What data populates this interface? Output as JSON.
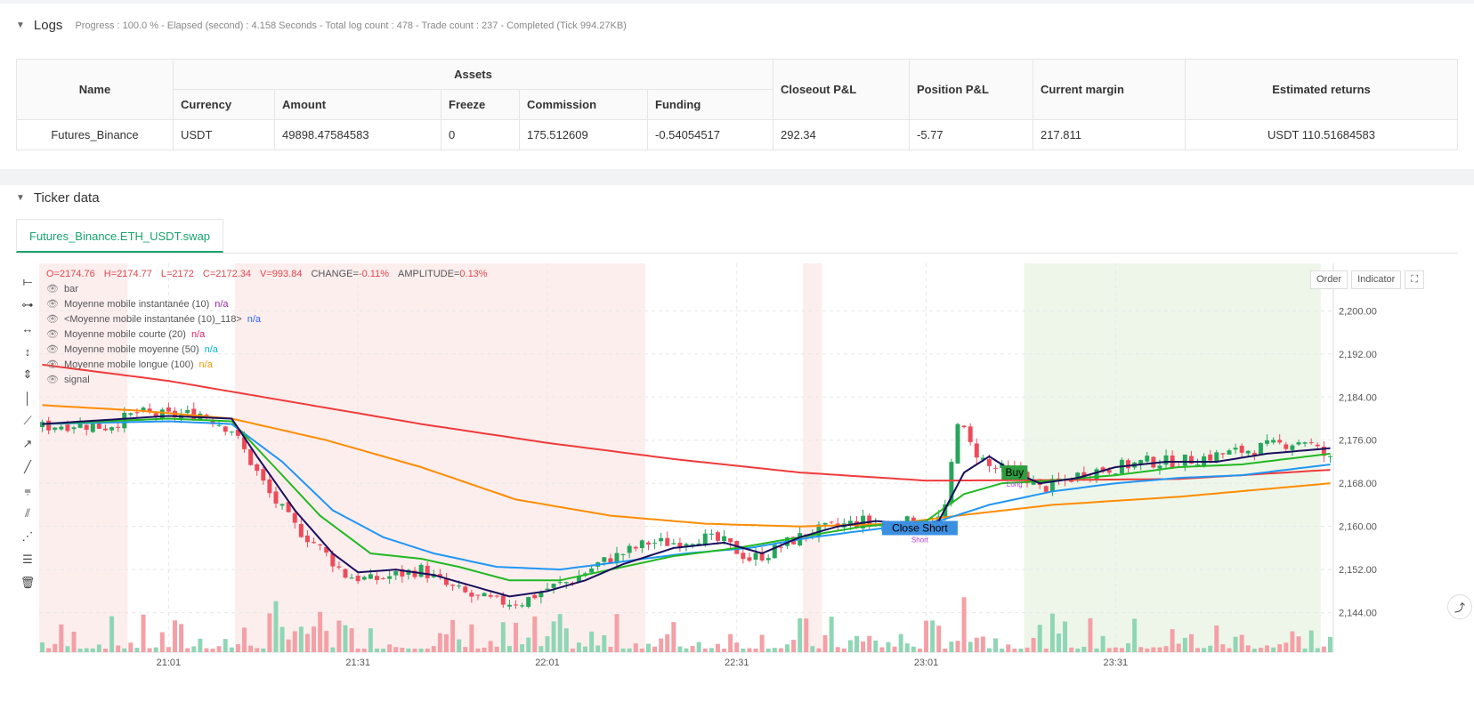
{
  "logs": {
    "title": "Logs",
    "progress": "Progress : 100.0 % - Elapsed (second) : 4.158  Seconds - Total log count : 478 - Trade count : 237 - Completed (Tick 994.27KB)",
    "table": {
      "h_name": "Name",
      "h_assets": "Assets",
      "h_currency": "Currency",
      "h_amount": "Amount",
      "h_freeze": "Freeze",
      "h_commission": "Commission",
      "h_funding": "Funding",
      "h_closeout": "Closeout P&L",
      "h_position": "Position P&L",
      "h_margin": "Current margin",
      "h_returns": "Estimated returns",
      "row": {
        "name": "Futures_Binance",
        "currency": "USDT",
        "amount": "49898.47584583",
        "freeze": "0",
        "commission": "175.512609",
        "funding": "-0.54054517",
        "closeout": "292.34",
        "position": "-5.77",
        "margin": "217.811",
        "returns": "USDT 110.51684583"
      }
    }
  },
  "ticker": {
    "title": "Ticker data",
    "tab": "Futures_Binance.ETH_USDT.swap",
    "buttons": {
      "order": "Order",
      "indicator": "Indicator"
    },
    "ohlc": {
      "o": "O=2174.76",
      "h": "H=2174.77",
      "l": "L=2172",
      "c": "C=2172.34",
      "v": "V=993.84",
      "change_label": "CHANGE=",
      "change": "-0.11%",
      "amp_label": "AMPLITUDE=",
      "amp": "0.13%"
    },
    "legend": [
      {
        "label": "bar",
        "value": ""
      },
      {
        "label": "Moyenne mobile instantanée (10)",
        "value": "n/a",
        "color": "#9c27b0"
      },
      {
        "label": "<Moyenne mobile instantanée (10)_118>",
        "value": "n/a",
        "color": "#2962ff"
      },
      {
        "label": "Moyenne mobile courte (20)",
        "value": "n/a",
        "color": "#e91e63"
      },
      {
        "label": "Moyenne mobile moyenne (50)",
        "value": "n/a",
        "color": "#00bcd4"
      },
      {
        "label": "Moyenne mobile longue (100)",
        "value": "n/a",
        "color": "#ff9800"
      },
      {
        "label": "signal",
        "value": ""
      }
    ]
  },
  "chart_data": {
    "type": "candlestick",
    "y_ticks": [
      "2,200.00",
      "2,192.00",
      "2,184.00",
      "2,176.00",
      "2,168.00",
      "2,160.00",
      "2,152.00",
      "2,144.00"
    ],
    "y_tick_values": [
      2200,
      2192,
      2184,
      2176,
      2168,
      2160,
      2152,
      2144
    ],
    "ylim": [
      2137.5,
      2208.8
    ],
    "x_ticks": [
      "21:01",
      "21:31",
      "22:01",
      "22:31",
      "23:01",
      "23:31"
    ],
    "x_tick_index": [
      20,
      50,
      80,
      110,
      140,
      170
    ],
    "bars": 205,
    "close_key_points": [
      [
        0,
        2178.5
      ],
      [
        5,
        2179
      ],
      [
        10,
        2178.5
      ],
      [
        15,
        2181
      ],
      [
        20,
        2180.5
      ],
      [
        25,
        2181
      ],
      [
        30,
        2178
      ],
      [
        33,
        2172
      ],
      [
        36,
        2166
      ],
      [
        40,
        2160
      ],
      [
        44,
        2156
      ],
      [
        48,
        2151
      ],
      [
        52,
        2150
      ],
      [
        56,
        2151
      ],
      [
        60,
        2152
      ],
      [
        64,
        2149
      ],
      [
        68,
        2147
      ],
      [
        72,
        2146
      ],
      [
        76,
        2146
      ],
      [
        80,
        2148.5
      ],
      [
        84,
        2150
      ],
      [
        88,
        2153
      ],
      [
        92,
        2155
      ],
      [
        96,
        2157
      ],
      [
        100,
        2157
      ],
      [
        104,
        2158
      ],
      [
        108,
        2157
      ],
      [
        112,
        2154
      ],
      [
        115,
        2155
      ],
      [
        118,
        2157
      ],
      [
        122,
        2159
      ],
      [
        126,
        2160
      ],
      [
        130,
        2161
      ],
      [
        134,
        2160
      ],
      [
        138,
        2161
      ],
      [
        141,
        2160
      ],
      [
        143,
        2163
      ],
      [
        145,
        2180
      ],
      [
        147,
        2175
      ],
      [
        150,
        2171
      ],
      [
        155,
        2170
      ],
      [
        158,
        2167
      ],
      [
        161,
        2168
      ],
      [
        165,
        2170
      ],
      [
        170,
        2171
      ],
      [
        175,
        2172
      ],
      [
        180,
        2172
      ],
      [
        185,
        2173
      ],
      [
        190,
        2174
      ],
      [
        195,
        2175
      ],
      [
        200,
        2176
      ],
      [
        204,
        2172.3
      ]
    ],
    "ma_lines": [
      {
        "name": "sma100",
        "color": "#ef3b3b",
        "points": [
          [
            0,
            2190
          ],
          [
            20,
            2187
          ],
          [
            40,
            2183
          ],
          [
            60,
            2179
          ],
          [
            80,
            2175.5
          ],
          [
            100,
            2172.5
          ],
          [
            120,
            2170
          ],
          [
            140,
            2168.5
          ],
          [
            160,
            2168.6
          ],
          [
            180,
            2168.8
          ],
          [
            204,
            2170.5
          ]
        ]
      },
      {
        "name": "sma50",
        "color": "#ff8c00",
        "points": [
          [
            0,
            2182.5
          ],
          [
            15,
            2181.5
          ],
          [
            30,
            2180
          ],
          [
            45,
            2176
          ],
          [
            60,
            2171
          ],
          [
            75,
            2165
          ],
          [
            90,
            2162
          ],
          [
            105,
            2160.5
          ],
          [
            120,
            2160
          ],
          [
            135,
            2160.5
          ],
          [
            145,
            2162
          ],
          [
            160,
            2164
          ],
          [
            180,
            2165.5
          ],
          [
            204,
            2168
          ]
        ]
      },
      {
        "name": "sma20",
        "color": "#2196f3",
        "points": [
          [
            0,
            2179
          ],
          [
            20,
            2179.5
          ],
          [
            30,
            2179
          ],
          [
            38,
            2172
          ],
          [
            46,
            2163
          ],
          [
            54,
            2158
          ],
          [
            62,
            2155
          ],
          [
            72,
            2152.5
          ],
          [
            82,
            2152
          ],
          [
            92,
            2153.5
          ],
          [
            102,
            2155
          ],
          [
            112,
            2156
          ],
          [
            122,
            2158
          ],
          [
            132,
            2159.5
          ],
          [
            142,
            2161
          ],
          [
            150,
            2164
          ],
          [
            160,
            2166.5
          ],
          [
            170,
            2168
          ],
          [
            180,
            2169
          ],
          [
            190,
            2169.5
          ],
          [
            204,
            2171.5
          ]
        ]
      },
      {
        "name": "ema10",
        "color": "#22b822",
        "points": [
          [
            0,
            2179
          ],
          [
            20,
            2180
          ],
          [
            30,
            2179.5
          ],
          [
            36,
            2172
          ],
          [
            44,
            2162
          ],
          [
            52,
            2155
          ],
          [
            60,
            2154
          ],
          [
            66,
            2152.5
          ],
          [
            74,
            2150
          ],
          [
            82,
            2150
          ],
          [
            90,
            2152
          ],
          [
            100,
            2154.5
          ],
          [
            110,
            2156
          ],
          [
            120,
            2158
          ],
          [
            130,
            2160
          ],
          [
            140,
            2161
          ],
          [
            146,
            2166
          ],
          [
            152,
            2168
          ],
          [
            160,
            2168.5
          ],
          [
            170,
            2169.5
          ],
          [
            180,
            2171
          ],
          [
            190,
            2171.5
          ],
          [
            204,
            2173.5
          ]
        ]
      },
      {
        "name": "inst",
        "color": "#1a0f5e",
        "points": [
          [
            0,
            2179
          ],
          [
            20,
            2180.5
          ],
          [
            30,
            2180
          ],
          [
            34,
            2173
          ],
          [
            40,
            2163
          ],
          [
            46,
            2155
          ],
          [
            50,
            2151.5
          ],
          [
            56,
            2152
          ],
          [
            62,
            2151
          ],
          [
            68,
            2149
          ],
          [
            74,
            2147
          ],
          [
            80,
            2148
          ],
          [
            86,
            2150
          ],
          [
            92,
            2153
          ],
          [
            100,
            2156
          ],
          [
            108,
            2157
          ],
          [
            114,
            2155
          ],
          [
            120,
            2158
          ],
          [
            126,
            2160
          ],
          [
            132,
            2161
          ],
          [
            138,
            2160.5
          ],
          [
            142,
            2161
          ],
          [
            146,
            2170
          ],
          [
            150,
            2173
          ],
          [
            154,
            2170
          ],
          [
            158,
            2168
          ],
          [
            164,
            2169
          ],
          [
            170,
            2171
          ],
          [
            178,
            2172
          ],
          [
            186,
            2172
          ],
          [
            194,
            2173.5
          ],
          [
            204,
            2174.5
          ]
        ]
      }
    ],
    "bg_zones": [
      {
        "from": 0,
        "to": 14,
        "color": "#fdeeee"
      },
      {
        "from": 31,
        "to": 96,
        "color": "#fdeeee"
      },
      {
        "from": 121,
        "to": 124,
        "color": "#fdeeee"
      },
      {
        "from": 156,
        "to": 203,
        "color": "#eef6ea"
      }
    ],
    "markers": [
      {
        "text": "Buy",
        "sub": "Long",
        "bar": 154,
        "price": 2170,
        "bg": "#2e9d3e",
        "fg": "#000"
      },
      {
        "text": "Close Short",
        "sub": "Short",
        "bar": 139,
        "price": 2159.7,
        "bg": "#3d8fe0",
        "fg": "#000"
      }
    ],
    "volume": "per-bar volume histogram"
  }
}
